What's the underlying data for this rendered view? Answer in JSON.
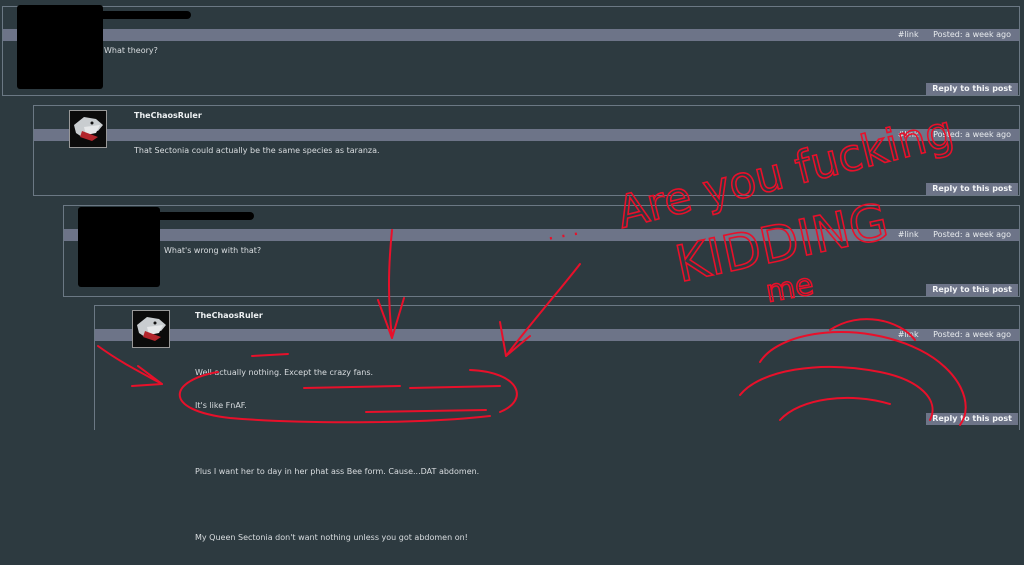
{
  "posts": [
    {
      "username": "",
      "link": "#link",
      "posted": "Posted: a week ago",
      "lines": [
        "What theory?"
      ],
      "reply": "Reply to this post"
    },
    {
      "username": "TheChaosRuler",
      "link": "#link",
      "posted": "Posted: a week ago",
      "lines": [
        "That Sectonia could actually be the same species as taranza."
      ],
      "reply": "Reply to this post"
    },
    {
      "username": "",
      "link": "#link",
      "posted": "Posted: a week ago",
      "lines": [
        "What's wrong with that?"
      ],
      "reply": "Reply to this post"
    },
    {
      "username": "TheChaosRuler",
      "link": "#link",
      "posted": "Posted: a week ago",
      "lines": [
        "Well actually nothing. Except the crazy fans.",
        "It's like FnAF.",
        "",
        "Plus I want her to day in her phat ass Bee form. Cause...DAT abdomen.",
        "",
        "My Queen Sectonia don't want nothing unless you got abdomen on!"
      ],
      "reply": "Reply to this post"
    }
  ],
  "annotation": {
    "dots": ". . .",
    "line1": "Are you fucking",
    "line2": "KIDDING",
    "line3": "me",
    "color": "#e8102a"
  },
  "colors": {
    "background": "#2d3a40",
    "bar": "#6d7488",
    "border": "#6b7884"
  }
}
